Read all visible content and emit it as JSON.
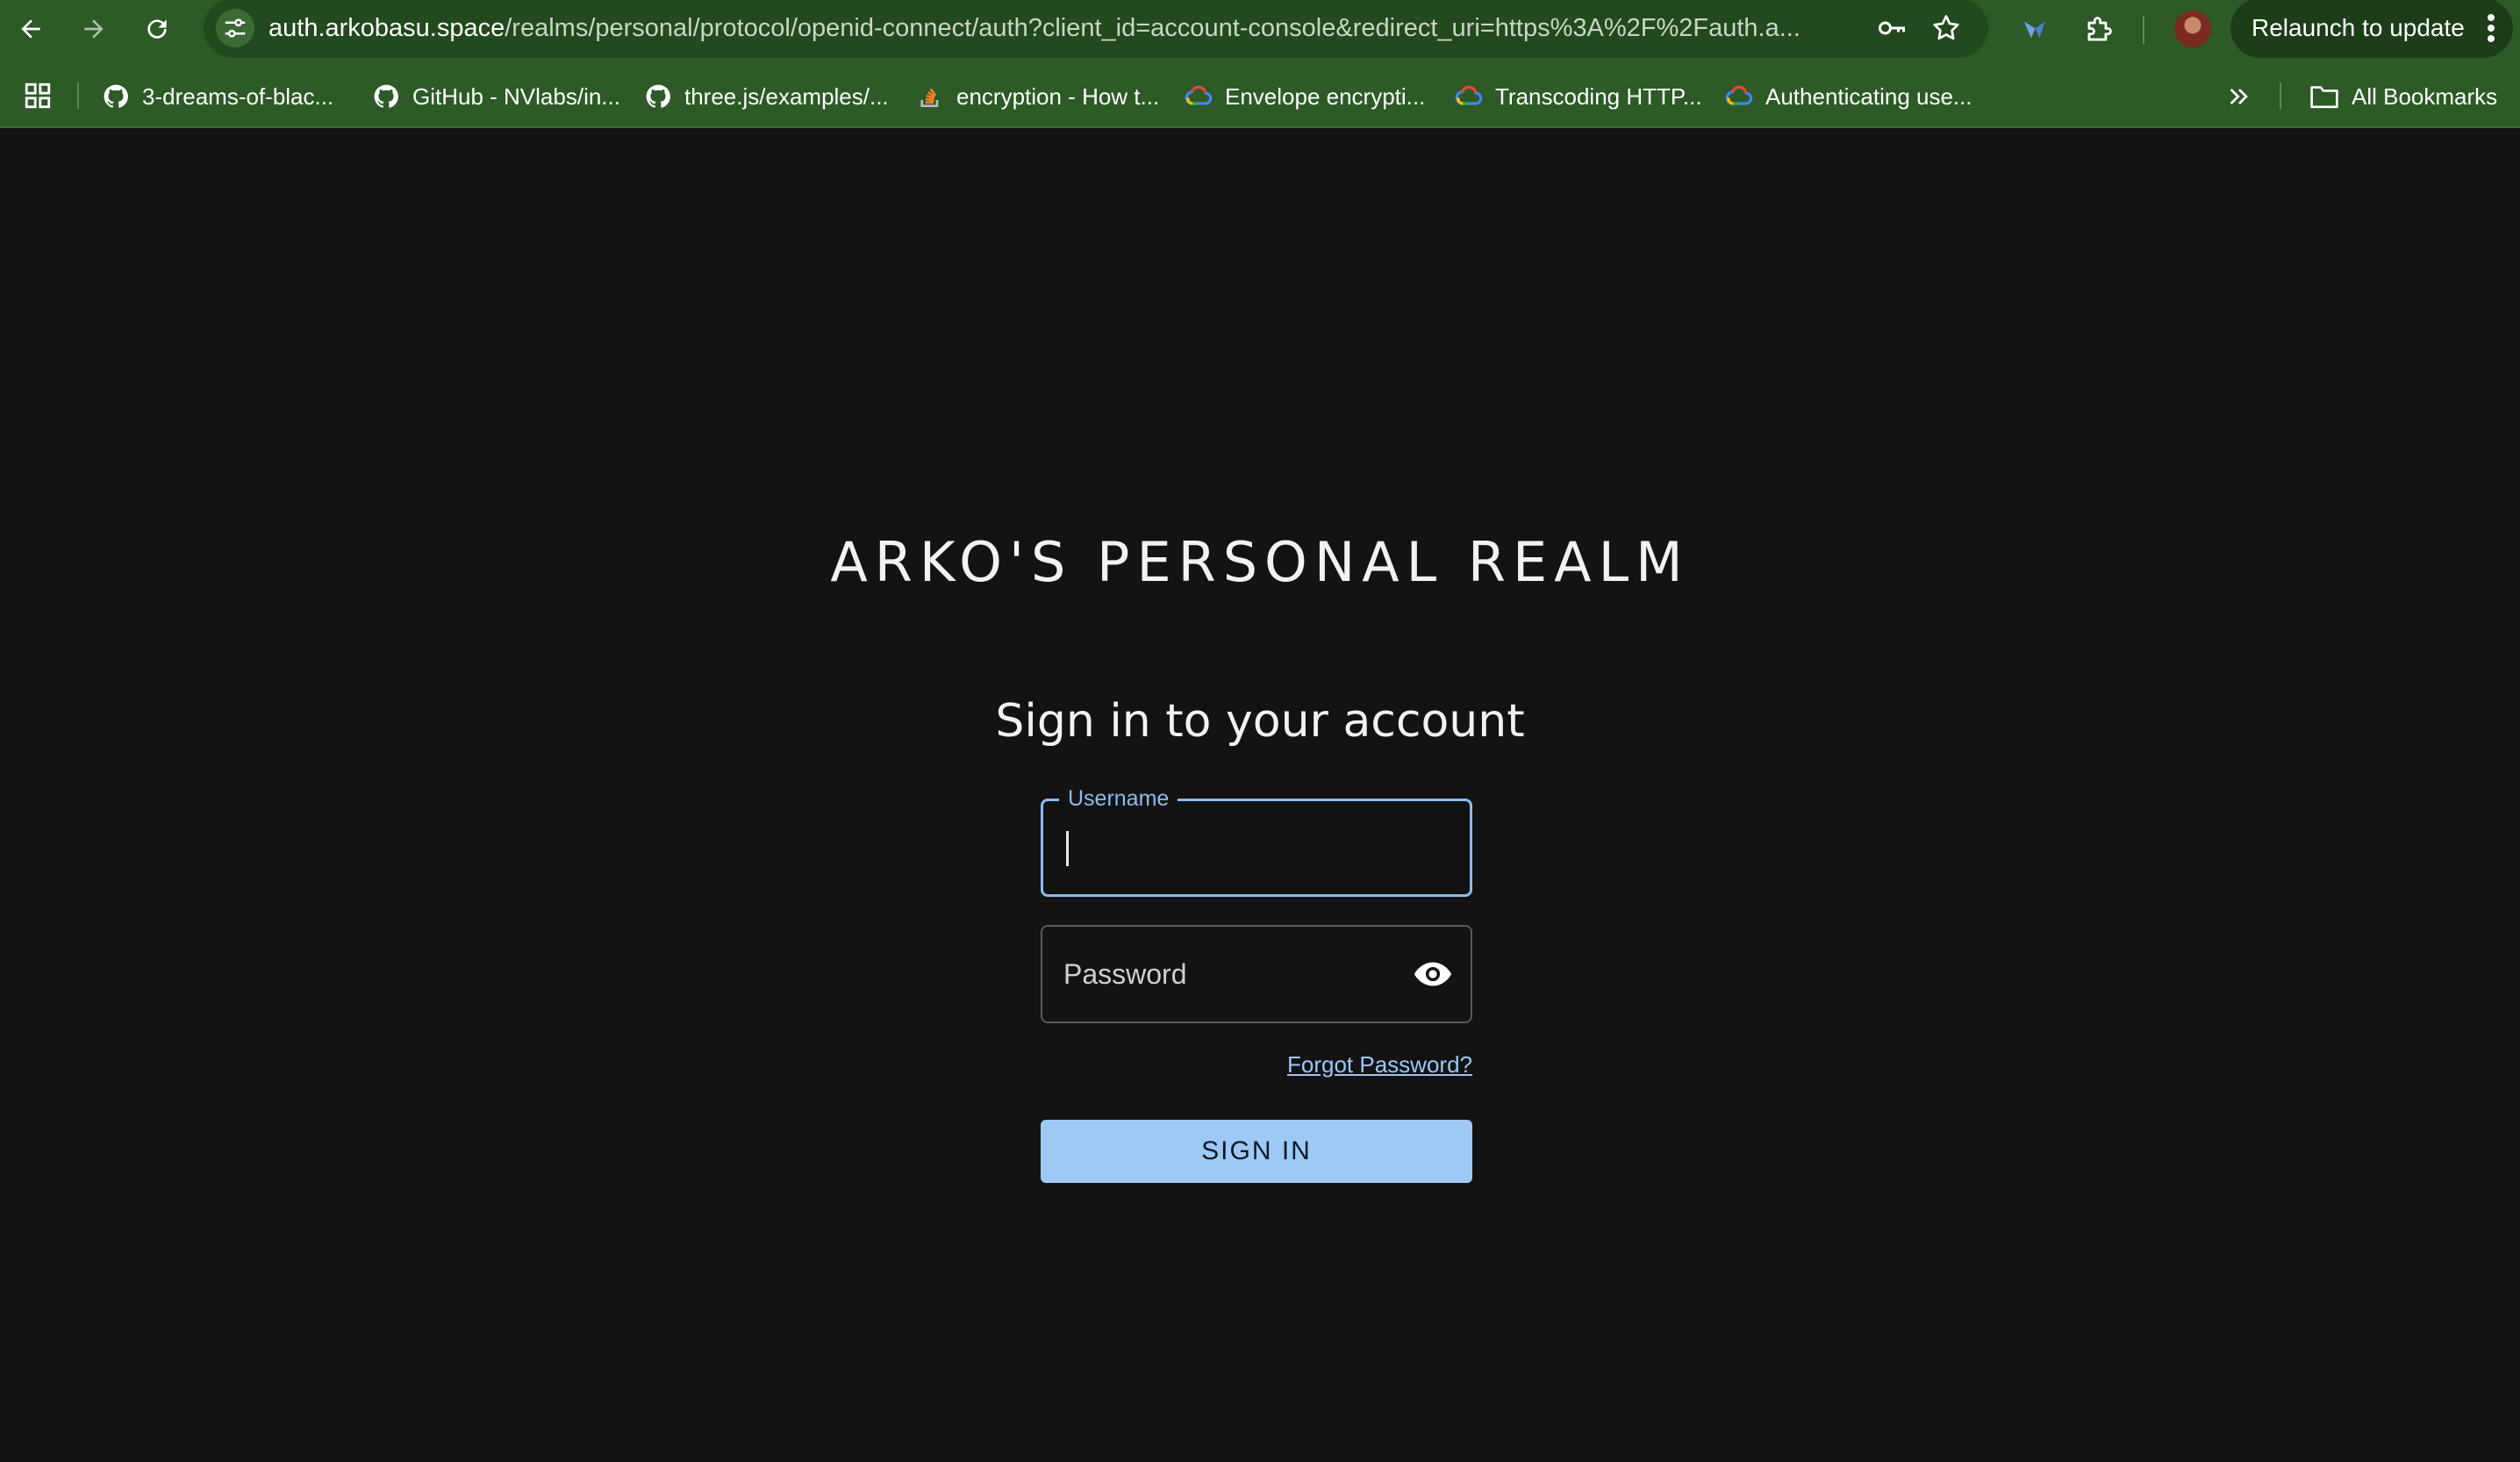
{
  "browser": {
    "url_host": "auth.arkobasu.space",
    "url_path": "/realms/personal/protocol/openid-connect/auth?client_id=account-console&redirect_uri=https%3A%2F%2Fauth.a...",
    "relaunch_label": "Relaunch to update",
    "bookmarks": [
      {
        "label": "3-dreams-of-blac...",
        "icon": "github-icon"
      },
      {
        "label": "GitHub - NVlabs/in...",
        "icon": "github-icon"
      },
      {
        "label": "three.js/examples/...",
        "icon": "github-icon"
      },
      {
        "label": "encryption - How t...",
        "icon": "stackoverflow-icon"
      },
      {
        "label": "Envelope encrypti...",
        "icon": "google-cloud-icon"
      },
      {
        "label": "Transcoding HTTP...",
        "icon": "google-cloud-icon"
      },
      {
        "label": "Authenticating use...",
        "icon": "google-cloud-icon"
      }
    ],
    "all_bookmarks_label": "All Bookmarks",
    "toolbar_color": "#2d5a27"
  },
  "page": {
    "realm_title": "ARKO'S PERSONAL REALM",
    "heading": "Sign in to your account",
    "username_label": "Username",
    "username_value": "",
    "password_placeholder": "Password",
    "forgot_password": "Forgot Password?",
    "sign_in_label": "SIGN IN",
    "accent_color": "#8bbcf0",
    "background_color": "#131313"
  }
}
